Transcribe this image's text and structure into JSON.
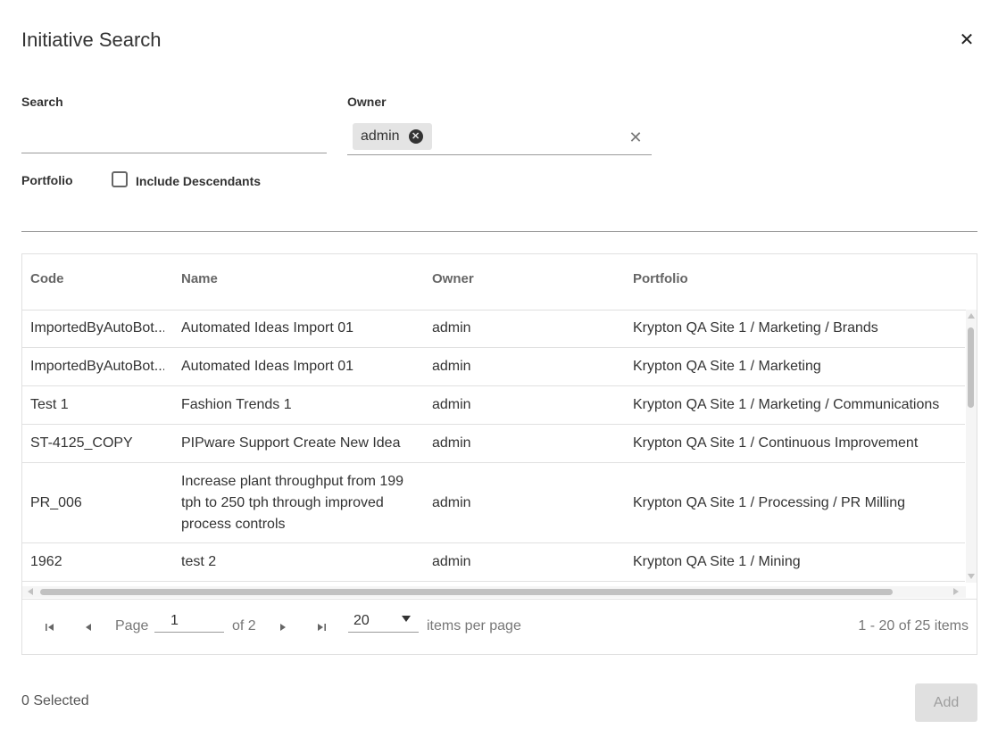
{
  "dialog": {
    "title": "Initiative Search"
  },
  "filters": {
    "search_label": "Search",
    "search_value": "",
    "owner_label": "Owner",
    "owner_chip": "admin",
    "portfolio_label": "Portfolio",
    "include_descendants_label": "Include Descendants",
    "include_descendants_checked": false
  },
  "grid": {
    "columns": [
      "Code",
      "Name",
      "Owner",
      "Portfolio"
    ],
    "rows": [
      {
        "code": "ImportedByAutoBot...",
        "name": "Automated Ideas Import 01",
        "owner": "admin",
        "portfolio": "Krypton QA Site 1 / Marketing / Brands"
      },
      {
        "code": "ImportedByAutoBot...",
        "name": "Automated Ideas Import 01",
        "owner": "admin",
        "portfolio": "Krypton QA Site 1 / Marketing"
      },
      {
        "code": "Test 1",
        "name": "Fashion Trends 1",
        "owner": "admin",
        "portfolio": "Krypton QA Site 1 / Marketing / Communications"
      },
      {
        "code": "ST-4125_COPY",
        "name": "PIPware Support Create New Idea",
        "owner": "admin",
        "portfolio": "Krypton QA Site 1 / Continuous Improvement"
      },
      {
        "code": "PR_006",
        "name": "Increase plant throughput from 199 tph to 250 tph through improved process controls",
        "owner": "admin",
        "portfolio": "Krypton QA Site 1 / Processing / PR Milling"
      },
      {
        "code": "1962",
        "name": "test 2",
        "owner": "admin",
        "portfolio": "Krypton QA Site 1 / Mining"
      }
    ]
  },
  "pager": {
    "page_label": "Page",
    "page_value": "1",
    "of_label": "of 2",
    "per_page_value": "20",
    "per_page_label": "items per page",
    "summary": "1 - 20 of 25 items"
  },
  "footer": {
    "selected_text": "0 Selected",
    "add_label": "Add"
  }
}
